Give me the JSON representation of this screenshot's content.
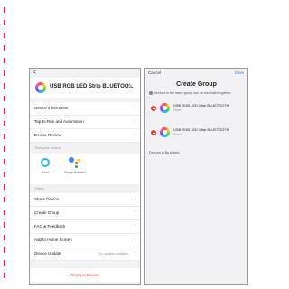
{
  "left_screen": {
    "back": "<",
    "device_title": "USB RGB LED Strip BLUETOO...",
    "edit_icon": "pencil-icon",
    "menu_top": [
      "Device Information",
      "Tap-to-Run and Automation",
      "Device Review"
    ],
    "third_party_label": "Third-party Control",
    "third_party": [
      {
        "name": "Alexa",
        "icon": "alexa-icon"
      },
      {
        "name": "Google Assistant",
        "icon": "google-assistant-icon"
      }
    ],
    "others_label": "Others",
    "menu_bottom": [
      "Share Device",
      "Create Group",
      "FAQ & Feedback",
      "Add to Home Screen"
    ],
    "device_update": {
      "label": "Device Update",
      "status": "No updates available"
    },
    "remove_label": "Remove Device"
  },
  "right_screen": {
    "cancel": "Cancel",
    "save": "Save",
    "title": "Create Group",
    "note": "Devices in the same group can be controlled together.",
    "devices": [
      {
        "name": "USB RGB LED Strip BLUETOOTH",
        "location": "Share"
      },
      {
        "name": "USB RGB LED Strip BLUETOOTH",
        "location": "Share"
      }
    ],
    "to_be_added_label": "Devices to Be Added"
  },
  "colors": {
    "accent": "#3a7bd5",
    "danger": "#e0413a",
    "dash": "#e8177d",
    "alexa": "#31b7e5"
  }
}
